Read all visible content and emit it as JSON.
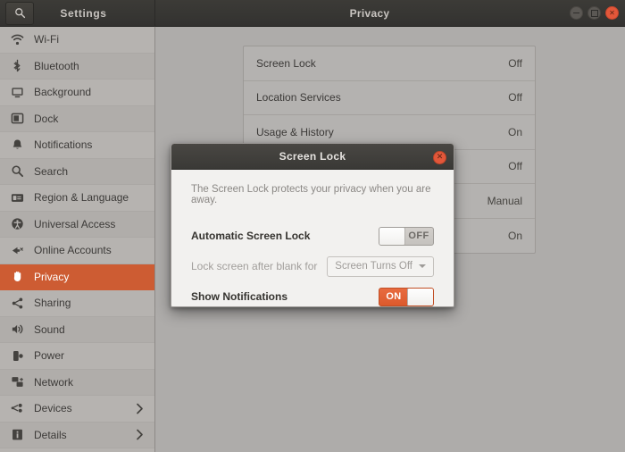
{
  "window": {
    "sidebar_title": "Settings",
    "main_title": "Privacy",
    "search_icon": "search-icon",
    "controls": {
      "minimize": "minimize-icon",
      "maximize": "maximize-icon",
      "close": "close-icon",
      "close_glyph": "✕"
    }
  },
  "sidebar": {
    "items": [
      {
        "label": "Wi-Fi",
        "icon": "wifi-icon",
        "selected": false,
        "chevron": false
      },
      {
        "label": "Bluetooth",
        "icon": "bluetooth-icon",
        "selected": false,
        "chevron": false
      },
      {
        "label": "Background",
        "icon": "background-icon",
        "selected": false,
        "chevron": false
      },
      {
        "label": "Dock",
        "icon": "dock-icon",
        "selected": false,
        "chevron": false
      },
      {
        "label": "Notifications",
        "icon": "bell-icon",
        "selected": false,
        "chevron": false
      },
      {
        "label": "Search",
        "icon": "search-icon",
        "selected": false,
        "chevron": false
      },
      {
        "label": "Region & Language",
        "icon": "region-language-icon",
        "selected": false,
        "chevron": false
      },
      {
        "label": "Universal Access",
        "icon": "accessibility-icon",
        "selected": false,
        "chevron": false
      },
      {
        "label": "Online Accounts",
        "icon": "online-accounts-icon",
        "selected": false,
        "chevron": false
      },
      {
        "label": "Privacy",
        "icon": "privacy-hand-icon",
        "selected": true,
        "chevron": false
      },
      {
        "label": "Sharing",
        "icon": "share-icon",
        "selected": false,
        "chevron": false
      },
      {
        "label": "Sound",
        "icon": "speaker-icon",
        "selected": false,
        "chevron": false
      },
      {
        "label": "Power",
        "icon": "power-icon",
        "selected": false,
        "chevron": false
      },
      {
        "label": "Network",
        "icon": "network-icon",
        "selected": false,
        "chevron": false
      },
      {
        "label": "Devices",
        "icon": "devices-icon",
        "selected": false,
        "chevron": true
      },
      {
        "label": "Details",
        "icon": "details-icon",
        "selected": false,
        "chevron": true
      }
    ]
  },
  "main": {
    "rows": [
      {
        "label": "Screen Lock",
        "value": "Off"
      },
      {
        "label": "Location Services",
        "value": "Off"
      },
      {
        "label": "Usage & History",
        "value": "On"
      },
      {
        "label": "",
        "value": "Off"
      },
      {
        "label": "",
        "value": "Manual"
      },
      {
        "label": "",
        "value": "On"
      }
    ]
  },
  "dialog": {
    "title": "Screen Lock",
    "close_glyph": "✕",
    "description": "The Screen Lock protects your privacy when you are away.",
    "rows": [
      {
        "label": "Automatic Screen Lock",
        "control": "switch",
        "state": "off",
        "state_label": "OFF",
        "disabled": false
      },
      {
        "label": "Lock screen after blank for",
        "control": "combo",
        "value": "Screen Turns Off",
        "disabled": true
      },
      {
        "label": "Show Notifications",
        "control": "switch",
        "state": "on",
        "state_label": "ON",
        "disabled": false
      }
    ]
  },
  "colors": {
    "accent": "#cd5c33",
    "toggle_on": "#e0612f",
    "titlebar": "#3a3936",
    "sidebar": "#b6b3b0",
    "content": "#aeacaa"
  }
}
